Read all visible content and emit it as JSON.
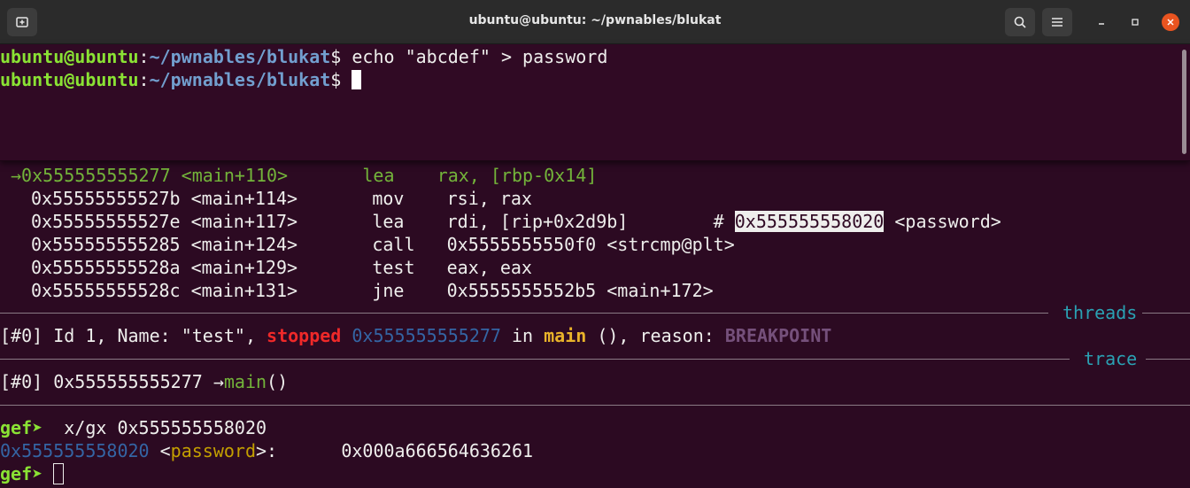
{
  "window": {
    "title": "ubuntu@ubuntu: ~/pwnables/blukat"
  },
  "prompt": {
    "user_host": "ubuntu@ubuntu",
    "colon": ":",
    "path": "~/pwnables/blukat",
    "dollar": "$"
  },
  "shell": {
    "cmd1": " echo \"abcdef\" > password"
  },
  "disasm": [
    {
      "arrow": "→",
      "addr": "0x555555555277",
      "sym": "<main+110>",
      "op": "lea",
      "args": "rax, [rbp-0x14]",
      "comment": ""
    },
    {
      "arrow": " ",
      "addr": "0x55555555527b",
      "sym": "<main+114>",
      "op": "mov",
      "args": "rsi, rax",
      "comment": ""
    },
    {
      "arrow": " ",
      "addr": "0x55555555527e",
      "sym": "<main+117>",
      "op": "lea",
      "args": "rdi, [rip+0x2d9b]",
      "comment_hash": "#",
      "comment_addr": "0x555555558020",
      "comment_sym": "<password>"
    },
    {
      "arrow": " ",
      "addr": "0x555555555285",
      "sym": "<main+124>",
      "op": "call",
      "args": "0x5555555550f0 <strcmp@plt>",
      "comment": ""
    },
    {
      "arrow": " ",
      "addr": "0x55555555528a",
      "sym": "<main+129>",
      "op": "test",
      "args": "eax, eax",
      "comment": ""
    },
    {
      "arrow": " ",
      "addr": "0x55555555528c",
      "sym": "<main+131>",
      "op": "jne",
      "args": "0x5555555552b5 <main+172>",
      "comment": ""
    }
  ],
  "threads": {
    "header": "threads",
    "idx": "[#0]",
    "text1": " Id 1, Name: \"test\", ",
    "status": "stopped",
    "addr": " 0x555555555277",
    "in": " in ",
    "func": "main",
    "text2": " (), reason: ",
    "reason": "BREAKPOINT"
  },
  "trace": {
    "header": "trace",
    "idx": "[#0]",
    "addr": " 0x555555555277 →",
    "func": "main",
    "parens": "()"
  },
  "gef": {
    "prompt": "gef➤",
    "cmd": "  x/gx 0x555555558020",
    "out_addr": "0x555555558020",
    "out_sym_open": " <",
    "out_sym": "password",
    "out_sym_close": ">:",
    "out_value": "      0x000a666564636261"
  }
}
